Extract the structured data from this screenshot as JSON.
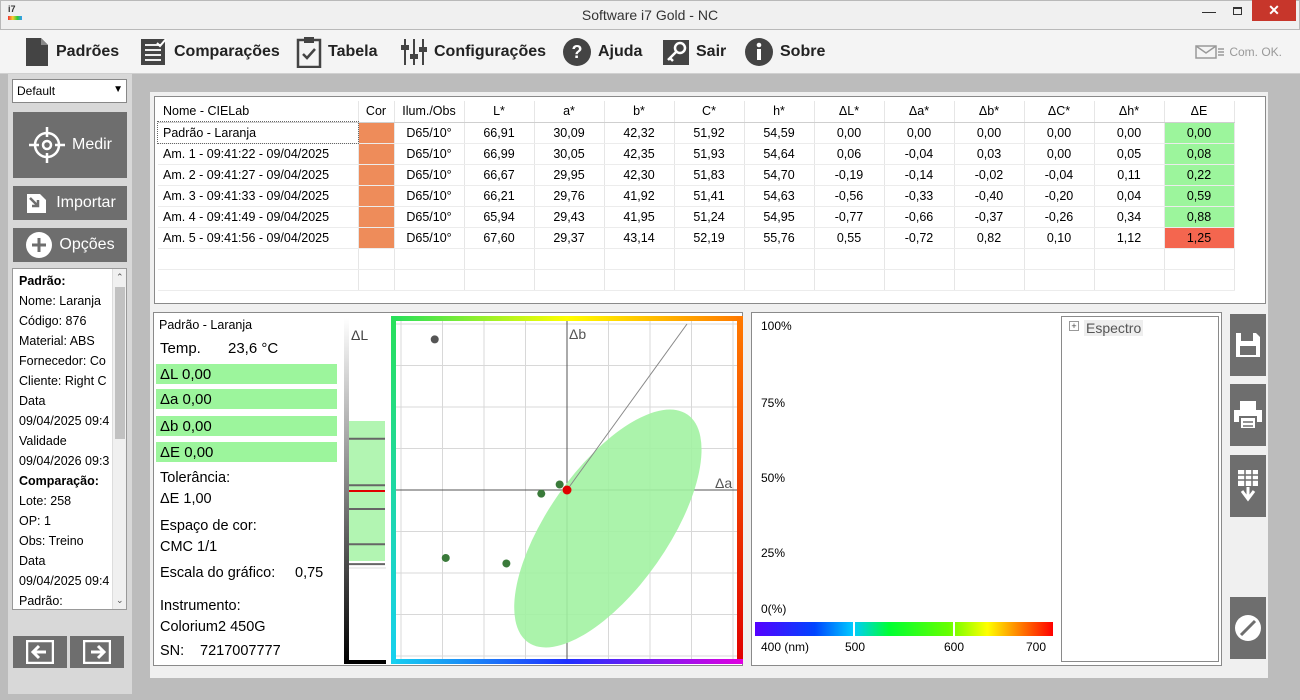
{
  "window": {
    "title": "Software i7 Gold - NC",
    "app_icon": "i7"
  },
  "menu": {
    "items": [
      {
        "label": "Padrões",
        "icon": "document-icon"
      },
      {
        "label": "Comparações",
        "icon": "checklist-icon"
      },
      {
        "label": "Tabela",
        "icon": "clipboard-icon"
      },
      {
        "label": "Configurações",
        "icon": "sliders-icon"
      },
      {
        "label": "Ajuda",
        "icon": "help-icon"
      },
      {
        "label": "Sair",
        "icon": "key-icon"
      },
      {
        "label": "Sobre",
        "icon": "info-icon"
      }
    ],
    "com_status": "Com. OK."
  },
  "left": {
    "profile": "Default",
    "measure_label": "Medir",
    "import_label": "Importar",
    "options_label": "Opções",
    "info_lines": [
      {
        "text": "Padrão:",
        "bold": true
      },
      {
        "text": "Nome: Laranja"
      },
      {
        "text": "Código: 876"
      },
      {
        "text": "Material: ABS"
      },
      {
        "text": "Fornecedor: Co"
      },
      {
        "text": "Cliente: Right C"
      },
      {
        "text": "Data"
      },
      {
        "text": "09/04/2025 09:4"
      },
      {
        "text": "Validade"
      },
      {
        "text": "09/04/2026 09:3"
      },
      {
        "text": "Comparação:",
        "bold": true
      },
      {
        "text": "Lote: 258"
      },
      {
        "text": "OP: 1"
      },
      {
        "text": "Obs: Treino"
      },
      {
        "text": "Data"
      },
      {
        "text": "09/04/2025 09:4"
      },
      {
        "text": "Padrão:"
      }
    ]
  },
  "table": {
    "headers": [
      "Nome - CIELab",
      "Cor",
      "Ilum./Obs",
      "L*",
      "a*",
      "b*",
      "C*",
      "h*",
      "ΔL*",
      "Δa*",
      "Δb*",
      "ΔC*",
      "Δh*",
      "ΔE"
    ],
    "rows": [
      {
        "name": "Padrão - Laranja",
        "ill": "D65/10°",
        "L": "66,91",
        "a": "30,09",
        "b": "42,32",
        "C": "51,92",
        "h": "54,59",
        "dL": "0,00",
        "da": "0,00",
        "db": "0,00",
        "dC": "0,00",
        "dh": "0,00",
        "dE": "0,00",
        "pass": true
      },
      {
        "name": "Am. 1 - 09:41:22 - 09/04/2025",
        "ill": "D65/10°",
        "L": "66,99",
        "a": "30,05",
        "b": "42,35",
        "C": "51,93",
        "h": "54,64",
        "dL": "0,06",
        "da": "-0,04",
        "db": "0,03",
        "dC": "0,00",
        "dh": "0,05",
        "dE": "0,08",
        "pass": true
      },
      {
        "name": "Am. 2 - 09:41:27 - 09/04/2025",
        "ill": "D65/10°",
        "L": "66,67",
        "a": "29,95",
        "b": "42,30",
        "C": "51,83",
        "h": "54,70",
        "dL": "-0,19",
        "da": "-0,14",
        "db": "-0,02",
        "dC": "-0,04",
        "dh": "0,11",
        "dE": "0,22",
        "pass": true
      },
      {
        "name": "Am. 3 - 09:41:33 - 09/04/2025",
        "ill": "D65/10°",
        "L": "66,21",
        "a": "29,76",
        "b": "41,92",
        "C": "51,41",
        "h": "54,63",
        "dL": "-0,56",
        "da": "-0,33",
        "db": "-0,40",
        "dC": "-0,20",
        "dh": "0,04",
        "dE": "0,59",
        "pass": true
      },
      {
        "name": "Am. 4 - 09:41:49 - 09/04/2025",
        "ill": "D65/10°",
        "L": "65,94",
        "a": "29,43",
        "b": "41,95",
        "C": "51,24",
        "h": "54,95",
        "dL": "-0,77",
        "da": "-0,66",
        "db": "-0,37",
        "dC": "-0,26",
        "dh": "0,34",
        "dE": "0,88",
        "pass": true
      },
      {
        "name": "Am. 5 - 09:41:56 - 09/04/2025",
        "ill": "D65/10°",
        "L": "67,60",
        "a": "29,37",
        "b": "43,14",
        "C": "52,19",
        "h": "55,76",
        "dL": "0,55",
        "da": "-0,72",
        "db": "0,82",
        "dC": "0,10",
        "dh": "1,12",
        "dE": "1,25",
        "pass": false
      }
    ],
    "swatch_color": "#ee8c5a",
    "pass_color": "#9cf59c",
    "fail_color": "#f4664f"
  },
  "details": {
    "standard": "Padrão - Laranja",
    "temp_label": "Temp.",
    "temp_value": "23,6 °C",
    "dL": "ΔL 0,00",
    "da": "Δa 0,00",
    "db": "Δb 0,00",
    "dE": "ΔE 0,00",
    "tol_label": "Tolerância:",
    "tol_value": "ΔE 1,00",
    "space_label": "Espaço de cor:",
    "space_value": "CMC 1/1",
    "scale_label": "Escala do gráfico:",
    "scale_value": "0,75",
    "instrument_label": "Instrumento:",
    "instrument_value": "Colorium2 450G",
    "sn_label": "SN:",
    "sn_value": "7217007777"
  },
  "chart_data": {
    "type": "scatter",
    "xlabel": "Δa",
    "ylabel": "Δb",
    "dl_label": "ΔL",
    "xlim": [
      -0.75,
      0.75
    ],
    "ylim": [
      -0.75,
      0.75
    ],
    "grid": true,
    "points": [
      {
        "x": 0.0,
        "y": 0.0,
        "standard": true
      },
      {
        "x": -0.04,
        "y": 0.03
      },
      {
        "x": -0.14,
        "y": -0.02
      },
      {
        "x": -0.33,
        "y": -0.4
      },
      {
        "x": -0.66,
        "y": -0.37
      },
      {
        "x": -0.72,
        "y": 0.82
      }
    ],
    "dl_values": [
      0.0,
      0.06,
      -0.19,
      -0.56,
      -0.77,
      0.55
    ]
  },
  "spectrum": {
    "y_ticks": [
      "100%",
      "75%",
      "50%",
      "25%",
      "0(%)"
    ],
    "x_ticks": [
      "400 (nm)",
      "500",
      "600",
      "700"
    ],
    "tree_label": "Espectro"
  }
}
